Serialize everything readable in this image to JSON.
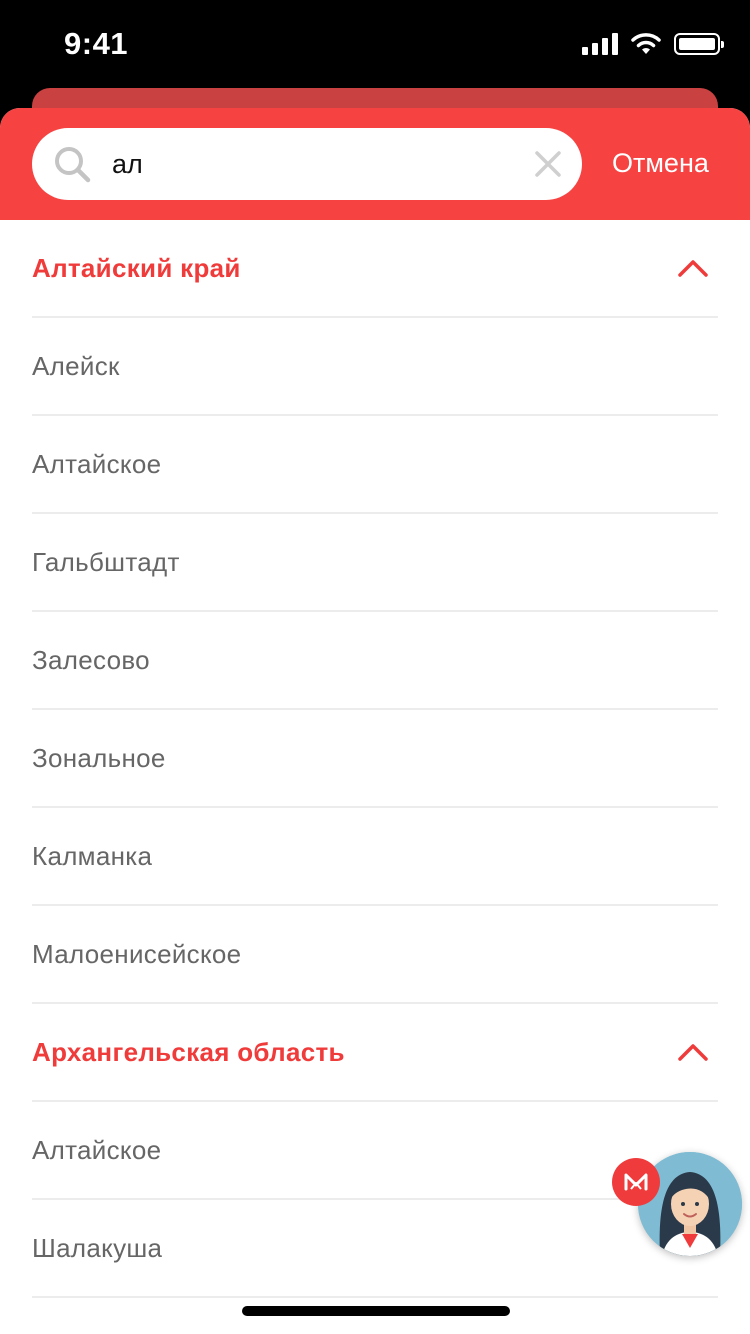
{
  "status_bar": {
    "time": "9:41",
    "icons": [
      "signal-icon",
      "wifi-icon",
      "battery-icon"
    ]
  },
  "search": {
    "query": "ал",
    "cancel_label": "Отмена",
    "icons": [
      "search-icon",
      "clear-icon"
    ]
  },
  "regions": [
    {
      "name": "Алтайский край",
      "expanded": true,
      "cities": [
        "Алейск",
        "Алтайское",
        "Гальбштадт",
        "Залесово",
        "Зональное",
        "Калманка",
        "Малоенисейское"
      ]
    },
    {
      "name": "Архангельская область",
      "expanded": true,
      "cities": [
        "Алтайское",
        "Шалакуша"
      ]
    }
  ],
  "colors": {
    "accent": "#f74242",
    "region_text": "#f03b3b",
    "city_text": "#666666",
    "divider": "#ececec"
  },
  "assistant": {
    "icons": [
      "brand-logo-icon",
      "assistant-avatar"
    ]
  }
}
